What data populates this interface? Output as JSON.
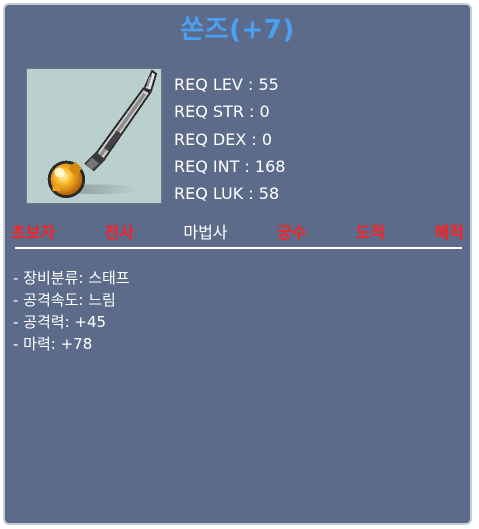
{
  "item": {
    "name": "쏜즈(+7)",
    "icon": "staff-weapon-icon",
    "name_color": "#4aa0f2"
  },
  "requirements": [
    {
      "label": "REQ LEV",
      "value": "55",
      "text": "REQ LEV : 55"
    },
    {
      "label": "REQ STR",
      "value": "0",
      "text": "REQ STR : 0"
    },
    {
      "label": "REQ DEX",
      "value": "0",
      "text": "REQ DEX : 0"
    },
    {
      "label": "REQ INT",
      "value": "168",
      "text": "REQ INT : 168"
    },
    {
      "label": "REQ LUK",
      "value": "58",
      "text": "REQ LUK : 58"
    }
  ],
  "jobs": [
    {
      "label": "초보자",
      "allowed": false
    },
    {
      "label": "전사",
      "allowed": false
    },
    {
      "label": "마법사",
      "allowed": true
    },
    {
      "label": "궁수",
      "allowed": false
    },
    {
      "label": "도적",
      "allowed": false
    },
    {
      "label": "해적",
      "allowed": false
    }
  ],
  "colors": {
    "panel_bg": "#5d6b8a",
    "blocked_job": "#ff1f1f",
    "allowed_job": "#ffffff"
  },
  "stats": [
    {
      "text": "- 장비분류: 스태프"
    },
    {
      "text": "- 공격속도: 느림"
    },
    {
      "text": "- 공격력: +45"
    },
    {
      "text": "- 마력: +78"
    }
  ]
}
